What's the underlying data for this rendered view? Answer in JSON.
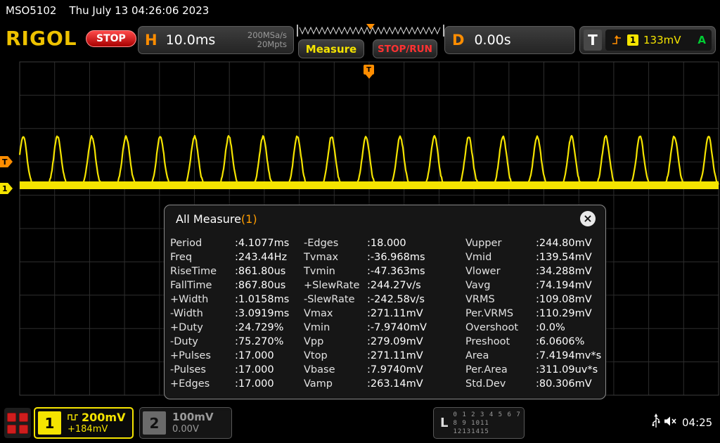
{
  "top_bar": {
    "model": "MSO5102",
    "datetime": "Thu July 13 04:26:06 2023"
  },
  "header": {
    "logo": "RIGOL",
    "run_state": "STOP",
    "horizontal": {
      "label": "H",
      "timebase": "10.0ms",
      "sample_rate": "200MSa/s",
      "memory_depth": "20Mpts"
    },
    "measure_button": "Measure",
    "stop_run_button": "STOP/RUN",
    "delay": {
      "label": "D",
      "value": "0.00s"
    },
    "trigger": {
      "label": "T",
      "source_channel": "1",
      "level": "133mV",
      "mode": "A"
    }
  },
  "waveform": {
    "trigger_marker": "T",
    "channel_marker": "1"
  },
  "measure_panel": {
    "title": "All Measure",
    "count": "(1)",
    "close_icon": "×",
    "columns": [
      [
        {
          "name": "Period",
          "value": ":4.1077ms"
        },
        {
          "name": "Freq",
          "value": ":243.44Hz"
        },
        {
          "name": "RiseTime",
          "value": ":861.80us"
        },
        {
          "name": "FallTime",
          "value": ":867.80us"
        },
        {
          "name": "+Width",
          "value": ":1.0158ms"
        },
        {
          "name": "-Width",
          "value": ":3.0919ms"
        },
        {
          "name": "+Duty",
          "value": ":24.729%"
        },
        {
          "name": "-Duty",
          "value": ":75.270%"
        },
        {
          "name": "+Pulses",
          "value": ":17.000"
        },
        {
          "name": "-Pulses",
          "value": ":17.000"
        },
        {
          "name": "+Edges",
          "value": ":17.000"
        }
      ],
      [
        {
          "name": "-Edges",
          "value": ":18.000"
        },
        {
          "name": "Tvmax",
          "value": ":-36.968ms"
        },
        {
          "name": "Tvmin",
          "value": ":-47.363ms"
        },
        {
          "name": "+SlewRate",
          "value": ":244.27v/s"
        },
        {
          "name": "-SlewRate",
          "value": ":-242.58v/s"
        },
        {
          "name": "Vmax",
          "value": ":271.11mV"
        },
        {
          "name": "Vmin",
          "value": ":-7.9740mV"
        },
        {
          "name": "Vpp",
          "value": ":279.09mV"
        },
        {
          "name": "Vtop",
          "value": ":271.11mV"
        },
        {
          "name": "Vbase",
          "value": ":7.9740mV"
        },
        {
          "name": "Vamp",
          "value": ":263.14mV"
        }
      ],
      [
        {
          "name": "Vupper",
          "value": ":244.80mV"
        },
        {
          "name": "Vmid",
          "value": ":139.54mV"
        },
        {
          "name": "Vlower",
          "value": ":34.288mV"
        },
        {
          "name": "Vavg",
          "value": ":74.194mV"
        },
        {
          "name": "VRMS",
          "value": ":109.08mV"
        },
        {
          "name": "Per.VRMS",
          "value": ":110.29mV"
        },
        {
          "name": "Overshoot",
          "value": ":0.0%"
        },
        {
          "name": "Preshoot",
          "value": ":6.0606%"
        },
        {
          "name": "Area",
          "value": ":7.4194mv*s"
        },
        {
          "name": "Per.Area",
          "value": ":311.09uv*s"
        },
        {
          "name": "Std.Dev",
          "value": ":80.306mV"
        }
      ]
    ]
  },
  "bottom_bar": {
    "channel1": {
      "number": "1",
      "scale": "200mV",
      "offset": "+184mV"
    },
    "channel2": {
      "number": "2",
      "scale": "100mV",
      "offset": "0.00V"
    },
    "logic": {
      "label": "L",
      "row1": "0 1 2 3  4 5 6 7",
      "row2": "8 9 1011 12131415"
    },
    "clock": "04:25"
  },
  "colors": {
    "channel1": "#f5e400",
    "channel2": "#9a9a9a",
    "trigger": "#ff8d00",
    "stop_red": "#e01010",
    "auto_green": "#00cc33"
  }
}
